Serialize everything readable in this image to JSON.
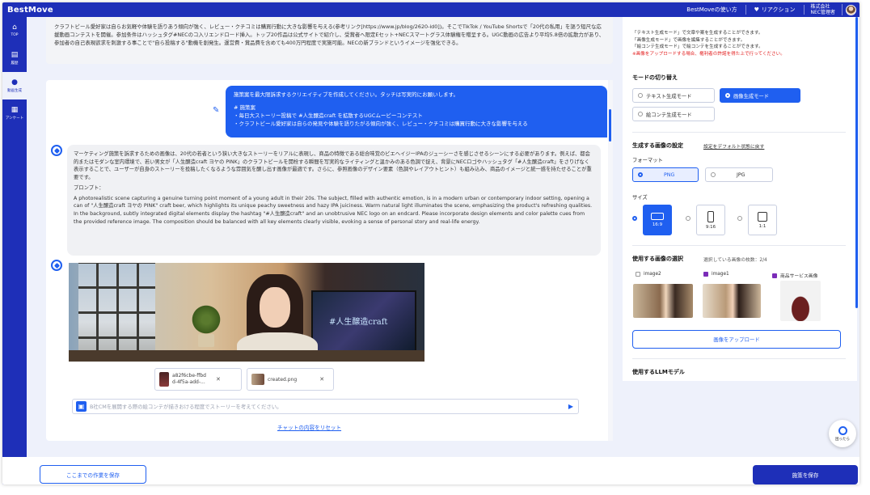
{
  "app": {
    "logo": "BestMove"
  },
  "topbar": {
    "help_label": "BestMoveの使い方",
    "reaction_label": "リアクション",
    "user_name_line1": "株式会社",
    "user_name_line2": "NEC管理者"
  },
  "leftnav": {
    "items": [
      {
        "label": "TOP",
        "icon": "home-icon"
      },
      {
        "label": "履歴",
        "icon": "document-icon"
      },
      {
        "label": "動画生成",
        "icon": "pin-icon"
      },
      {
        "label": "アンケート",
        "icon": "building-icon"
      }
    ]
  },
  "chat": {
    "context_text": "クラフトビール愛好家は自らお気軽や体験を語りあう傾向が強く、レビュー・クチコミは購買行動に大きな影響を与える(参考リンク[https://www.jp/blog/2620-id0])。そこでTikTok / YouTube Shortsで「20代の私用」を謳う短尺な応援動画コンテストを開催。参加条件はハッシュタグ#NECのコ入リエンドロード挿入。トップ20作品は公式サイトで紹介し、受賞者へ限定Eセット+NECスマートグラス体験権を贈呈する。UGC動画の広告より平均5.8倍の拡散力があり、参加者の自己表現欲求を刺激する事ことで\"自ら投稿する\"動機を創発生。運営費・賞品費を含めても400万円程度で実施可能。NECの新ブランドというイメージを強化できる。",
    "user_message": {
      "line1": "施策案を最大限訴求するクリエイティブを作成してください。タッチは写実的にお願いします。",
      "line2": "# 施策案",
      "line3": "・毎日大ストーリー投稿で #人生醸造craft を拡散するUGCムービーコンテスト",
      "line4": "・クラフトビール愛好家は自らの発見や体験を語りたがる傾向が強く、レビュー・クチコミは購買行動に大きな影響を与える"
    },
    "bot_message": {
      "intro": "マーケティング施策を訴求するための画像は、20代の若者という狭い大きなストーリーをリアルに表現し、商品の特徴である総合味覚のビエヘイジーIPAのジューシーさを感じさせるシーンにする必要があります。例えば、都会的またはモダンな室内環境で、若い男女が「人生醸造craft ヨヤの PINK」のクラフトビールを開栓する瞬間を写実的なライティングと温かみのある色調で捉え、背景にNECロゴやハッシュタグ「#人生醸造craft」をさりげなく表示することで、ユーザーが自身のストーリーを投稿したくなるような雰囲気を醸し出す画像が最適です。さらに、参照画像のデザイン要素（色調やレイアウトヒント）も組み込み、商品のイメージと統一感を持たせることが重要です。",
      "prompt_label": "プロンプト：",
      "prompt_text": "A photorealistic scene capturing a genuine turning point moment of a young adult in their 20s. The subject, filled with authentic emotion, is in a modern urban or contemporary indoor setting, opening a can of \"人生醸造craft ヨヤの PINK\" craft beer, which highlights its unique peachy sweetness and hazy IPA juiciness. Warm natural light illuminates the scene, emphasizing the product's refreshing qualities. In the background, subtly integrated digital elements display the hashtag \"#人生醸造craft\" and an unobtrusive NEC logo on an endcard. Please incorporate design elements and color palette cues from the provided reference image. The composition should be balanced with all key elements clearly visible, evoking a sense of personal story and real-life energy."
    },
    "generated_image": {
      "tv_text": "#人生醸造craft"
    },
    "attachments": [
      {
        "name_line1": "a82f6cbe-ffbd",
        "name_line2": "d-4f5a-add-..."
      },
      {
        "name_line1": "created.png",
        "name_line2": ""
      }
    ],
    "input": {
      "placeholder": "B社CMを展開する際の絵コンテが描きおける程度でストーリーを考えてください。"
    },
    "reset_link": "チャットの内容をリセット"
  },
  "settings": {
    "mode_notes": [
      "「テキスト生成モード」で文章や案を生成することができます。",
      "「画像生成モード」で画像を編集することができます。",
      "「絵コンテ生成モード」で絵コンテを生成することができます。"
    ],
    "mode_warning": "※画像をアップロードする場合、権利者の許諾を得た上で行ってください。",
    "mode_title": "モードの切り替え",
    "modes": [
      {
        "label": "テキスト生成モード",
        "selected": false
      },
      {
        "label": "画像生成モード",
        "selected": true
      },
      {
        "label": "絵コンテ生成モード",
        "selected": false
      }
    ],
    "image_settings_title": "生成する画像の設定",
    "reset_default_link": "設定をデフォルト状態に戻す",
    "format_label": "フォーマット",
    "formats": [
      {
        "label": "PNG",
        "selected": true
      },
      {
        "label": "JPG",
        "selected": false
      }
    ],
    "size_label": "サイズ",
    "sizes": [
      {
        "label": "16:9",
        "selected": true
      },
      {
        "label": "9:16",
        "selected": false
      },
      {
        "label": "1:1",
        "selected": false
      }
    ],
    "reference_title": "使用する画像の選択",
    "reference_count": "選択している画像の枚数：2/4",
    "references": [
      {
        "label": "image2",
        "checked": false
      },
      {
        "label": "image1",
        "checked": true
      },
      {
        "label": "商品サービス画像",
        "checked": true
      }
    ],
    "upload_label": "画像をアップロード",
    "llm_title": "使用するLLMモデル"
  },
  "footer": {
    "save_draft_label": "ここまでの作業を保存",
    "save_label": "施策を保存",
    "help_fab_label": "困ったら"
  },
  "colors": {
    "brand": "#1e2fb8",
    "accent": "#1f5ff0",
    "warning": "#e21b1b"
  }
}
